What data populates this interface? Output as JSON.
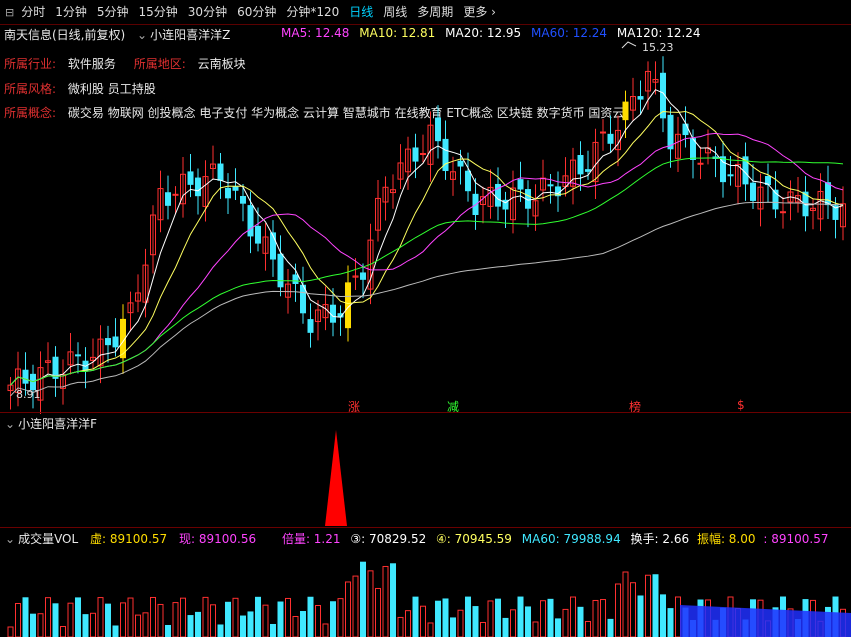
{
  "tabs": [
    "分时",
    "1分钟",
    "5分钟",
    "15分钟",
    "30分钟",
    "60分钟",
    "分钟*120",
    "日线",
    "周线",
    "多周期",
    "更多"
  ],
  "active_tab": "日线",
  "stock": {
    "title": "南天信息(日线,前复权)",
    "indicator_name": "小连阳喜洋洋Z",
    "industry_label": "所属行业:",
    "industry": "软件服务",
    "region_label": "所属地区:",
    "region": "云南板块",
    "style_label": "所属风格:",
    "style": "微利股 员工持股",
    "concept_label": "所属概念:",
    "concepts": "碳交易 物联网 创投概念 电子支付 华为概念 云计算 智慧城市 在线教育 ETC概念 区块链 数字货币 国资云"
  },
  "ma": {
    "ma5": "MA5: 12.48",
    "ma10": "MA10: 12.81",
    "ma20": "MA20: 12.95",
    "ma60": "MA60: 12.24",
    "ma120": "MA120: 12.24"
  },
  "colors": {
    "ma5": "#ff44ff",
    "ma10": "#ffff60",
    "ma20": "#ffffff",
    "ma60": "#2050ff",
    "ma120": "#ffffff",
    "up": "#ff3030",
    "down": "#40e8ff",
    "yellow": "#ffdd00"
  },
  "markers": {
    "high": "15.23",
    "low": "8.91",
    "zhang": "涨",
    "jian": "减",
    "bang": "榜",
    "dollar": "$"
  },
  "sub_indicator": "小连阳喜洋洋F",
  "volume": {
    "name": "成交量VOL",
    "xu": "虚: 89100.57",
    "xian": "现: 89100.56",
    "beiliang": "倍量: 1.21",
    "v3": "③: 70829.52",
    "v4": "④: 70945.59",
    "ma60": "MA60: 79988.94",
    "huanshou": "换手: 2.66",
    "zhenfu": "振幅: 8.00",
    "last": ": 89100.57"
  }
}
